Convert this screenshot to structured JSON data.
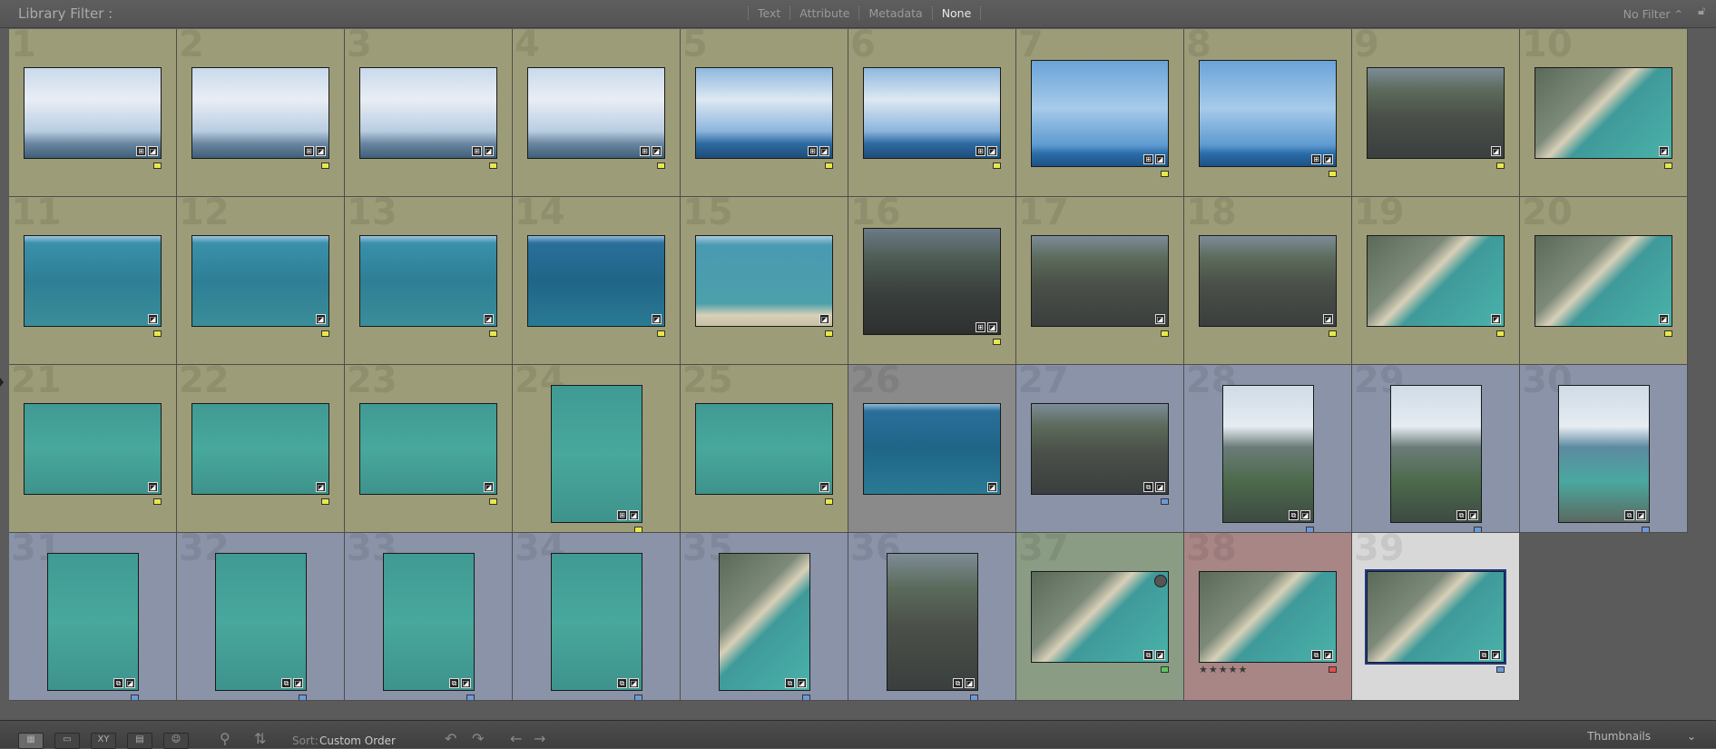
{
  "filter_bar": {
    "label": "Library Filter :",
    "modes": [
      "Text",
      "Attribute",
      "Metadata",
      "None"
    ],
    "selected_mode": "None",
    "preset": "No Filter"
  },
  "colors": {
    "yellow_bg": "#9c9c78",
    "gray_bg": "#8a8a8a",
    "blue_bg": "#8a93a8",
    "green_bg": "#8a9c84",
    "red_bg": "#a98686",
    "selected_bg": "#d8d8d8",
    "label_yellow": "#e8e84a",
    "label_blue": "#6c9ad8",
    "label_green": "#5cc45c",
    "label_red": "#e05050"
  },
  "photos": [
    {
      "n": "1",
      "label": "yellow",
      "orient": "L",
      "img": "clouds",
      "badges": [
        "crop",
        "edit"
      ]
    },
    {
      "n": "2",
      "label": "yellow",
      "orient": "L",
      "img": "clouds",
      "badges": [
        "crop",
        "edit"
      ]
    },
    {
      "n": "3",
      "label": "yellow",
      "orient": "L",
      "img": "clouds",
      "badges": [
        "crop",
        "edit"
      ]
    },
    {
      "n": "4",
      "label": "yellow",
      "orient": "L",
      "img": "clouds",
      "badges": [
        "crop",
        "edit"
      ]
    },
    {
      "n": "5",
      "label": "yellow",
      "orient": "L",
      "img": "clouds2",
      "badges": [
        "crop",
        "edit"
      ]
    },
    {
      "n": "6",
      "label": "yellow",
      "orient": "L",
      "img": "clouds2",
      "badges": [
        "crop",
        "edit"
      ]
    },
    {
      "n": "7",
      "label": "yellow",
      "orient": "L2",
      "img": "sky",
      "badges": [
        "crop",
        "edit"
      ]
    },
    {
      "n": "8",
      "label": "yellow",
      "orient": "L2",
      "img": "sky",
      "badges": [
        "crop",
        "edit"
      ]
    },
    {
      "n": "9",
      "label": "yellow",
      "orient": "L",
      "img": "city",
      "badges": [
        "edit"
      ]
    },
    {
      "n": "10",
      "label": "yellow",
      "orient": "L",
      "img": "shore",
      "badges": [
        "edit"
      ]
    },
    {
      "n": "11",
      "label": "yellow",
      "orient": "L",
      "img": "lake",
      "badges": [
        "edit"
      ]
    },
    {
      "n": "12",
      "label": "yellow",
      "orient": "L",
      "img": "lake",
      "badges": [
        "edit"
      ]
    },
    {
      "n": "13",
      "label": "yellow",
      "orient": "L",
      "img": "lake",
      "badges": [
        "edit"
      ]
    },
    {
      "n": "14",
      "label": "yellow",
      "orient": "L",
      "img": "lakedark",
      "badges": [
        "edit"
      ]
    },
    {
      "n": "15",
      "label": "yellow",
      "orient": "L",
      "img": "lakebeach",
      "badges": [
        "edit"
      ]
    },
    {
      "n": "16",
      "label": "yellow",
      "orient": "L2",
      "img": "citydark",
      "badges": [
        "crop",
        "edit"
      ]
    },
    {
      "n": "17",
      "label": "yellow",
      "orient": "L",
      "img": "city",
      "badges": [
        "edit"
      ]
    },
    {
      "n": "18",
      "label": "yellow",
      "orient": "L",
      "img": "city",
      "badges": [
        "edit"
      ]
    },
    {
      "n": "19",
      "label": "yellow",
      "orient": "L",
      "img": "shore",
      "badges": [
        "edit"
      ]
    },
    {
      "n": "20",
      "label": "yellow",
      "orient": "L",
      "img": "shore",
      "badges": [
        "edit"
      ]
    },
    {
      "n": "21",
      "label": "yellow",
      "orient": "L",
      "img": "green",
      "badges": [
        "edit"
      ]
    },
    {
      "n": "22",
      "label": "yellow",
      "orient": "L",
      "img": "green",
      "badges": [
        "edit"
      ]
    },
    {
      "n": "23",
      "label": "yellow",
      "orient": "L",
      "img": "green",
      "badges": [
        "edit"
      ]
    },
    {
      "n": "24",
      "label": "yellow",
      "orient": "P",
      "img": "green",
      "badges": [
        "crop",
        "edit"
      ]
    },
    {
      "n": "25",
      "label": "yellow",
      "orient": "L",
      "img": "green",
      "badges": [
        "edit"
      ]
    },
    {
      "n": "26",
      "label": "gray",
      "orient": "L",
      "img": "lakedark",
      "badges": [
        "edit"
      ]
    },
    {
      "n": "27",
      "label": "blue",
      "orient": "L",
      "img": "city",
      "badges": [
        "stack",
        "edit"
      ]
    },
    {
      "n": "28",
      "label": "blue",
      "orient": "P",
      "img": "cityp",
      "badges": [
        "stack",
        "edit"
      ]
    },
    {
      "n": "29",
      "label": "blue",
      "orient": "P",
      "img": "cityp",
      "badges": [
        "stack",
        "edit"
      ]
    },
    {
      "n": "30",
      "label": "blue",
      "orient": "P",
      "img": "shorep",
      "badges": [
        "stack",
        "edit"
      ]
    },
    {
      "n": "31",
      "label": "blue",
      "orient": "P",
      "img": "green",
      "badges": [
        "stack",
        "edit"
      ]
    },
    {
      "n": "32",
      "label": "blue",
      "orient": "P",
      "img": "green",
      "badges": [
        "stack",
        "edit"
      ]
    },
    {
      "n": "33",
      "label": "blue",
      "orient": "P",
      "img": "green",
      "badges": [
        "stack",
        "edit"
      ]
    },
    {
      "n": "34",
      "label": "blue",
      "orient": "P",
      "img": "green",
      "badges": [
        "stack",
        "edit"
      ]
    },
    {
      "n": "35",
      "label": "blue",
      "orient": "P",
      "img": "shore",
      "badges": [
        "stack",
        "edit"
      ]
    },
    {
      "n": "36",
      "label": "blue",
      "orient": "P",
      "img": "city",
      "badges": [
        "stack",
        "edit"
      ]
    },
    {
      "n": "37",
      "label": "green",
      "orient": "L",
      "img": "shore",
      "badges": [
        "stack",
        "edit"
      ],
      "circle": true
    },
    {
      "n": "38",
      "label": "red",
      "orient": "L",
      "img": "shore",
      "badges": [
        "stack",
        "edit"
      ],
      "stars": "★★★★★"
    },
    {
      "n": "39",
      "label": "selected",
      "orient": "L",
      "img": "shore",
      "badges": [
        "stack",
        "edit"
      ]
    }
  ],
  "toolbar": {
    "sort_label": "Sort:",
    "sort_value": "Custom Order",
    "panel_label": "Thumbnails"
  }
}
